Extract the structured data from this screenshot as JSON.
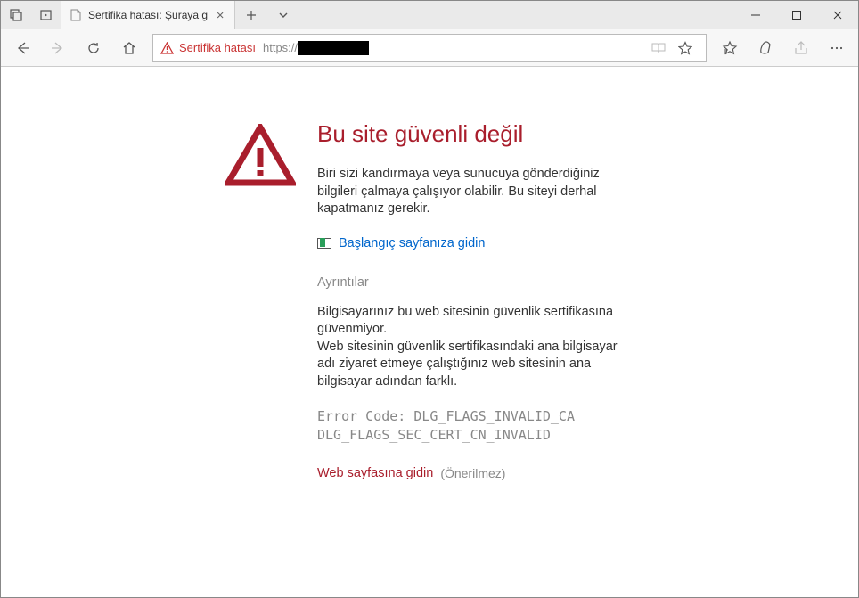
{
  "titlebar": {
    "tab_title": "Sertifika hatası: Şuraya g"
  },
  "addressbar": {
    "cert_label": "Sertifika hatası",
    "url_prefix": "https://"
  },
  "page": {
    "title": "Bu site güvenli değil",
    "description": "Biri sizi kandırmaya veya sunucuya gönderdiğiniz bilgileri çalmaya çalışıyor olabilir. Bu siteyi derhal kapatmanız gerekir.",
    "go_home": "Başlangıç sayfanıza gidin",
    "details_header": "Ayrıntılar",
    "details_line1": "Bilgisayarınız bu web sitesinin güvenlik sertifikasına güvenmiyor.",
    "details_line2": "Web sitesinin güvenlik sertifikasındaki ana bilgisayar adı ziyaret etmeye çalıştığınız web sitesinin ana bilgisayar adından farklı.",
    "error_code_label": "Error Code: ",
    "error_code_1": "DLG_FLAGS_INVALID_CA",
    "error_code_2": "DLG_FLAGS_SEC_CERT_CN_INVALID",
    "continue_link": "Web sayfasına gidin",
    "continue_note": "(Önerilmez)"
  }
}
